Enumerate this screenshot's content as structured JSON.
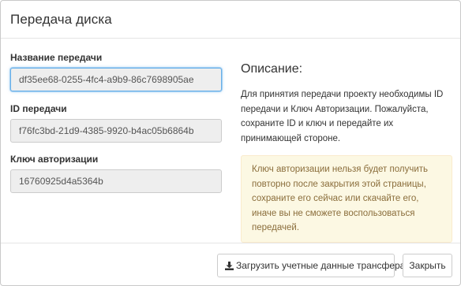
{
  "modal": {
    "title": "Передача диска"
  },
  "form": {
    "transfer_name": {
      "label": "Название передачи",
      "value": "df35ee68-0255-4fc4-a9b9-86c7698905ae"
    },
    "transfer_id": {
      "label": "ID передачи",
      "value": "f76fc3bd-21d9-4385-9920-b4ac05b6864b"
    },
    "auth_key": {
      "label": "Ключ авторизации",
      "value": "16760925d4a5364b"
    }
  },
  "description": {
    "title": "Описание:",
    "text": "Для принятия передачи проекту необходимы ID передачи и Ключ Авторизации. Пожалуйста, сохраните ID и ключ и передайте их принимающей стороне.",
    "warning": "Ключ авторизации нельзя будет получить повторно после закрытия этой страницы, сохраните его сейчас или скачайте его, иначе вы не сможете воспользоваться передачей."
  },
  "footer": {
    "download_label": "Загрузить учетные данные трансфера",
    "close_label": "Закрыть",
    "download_icon": "download-icon"
  },
  "colors": {
    "warning_bg": "#fcf8e3",
    "warning_text": "#8a6d3b",
    "focus_border": "#66afe9"
  }
}
